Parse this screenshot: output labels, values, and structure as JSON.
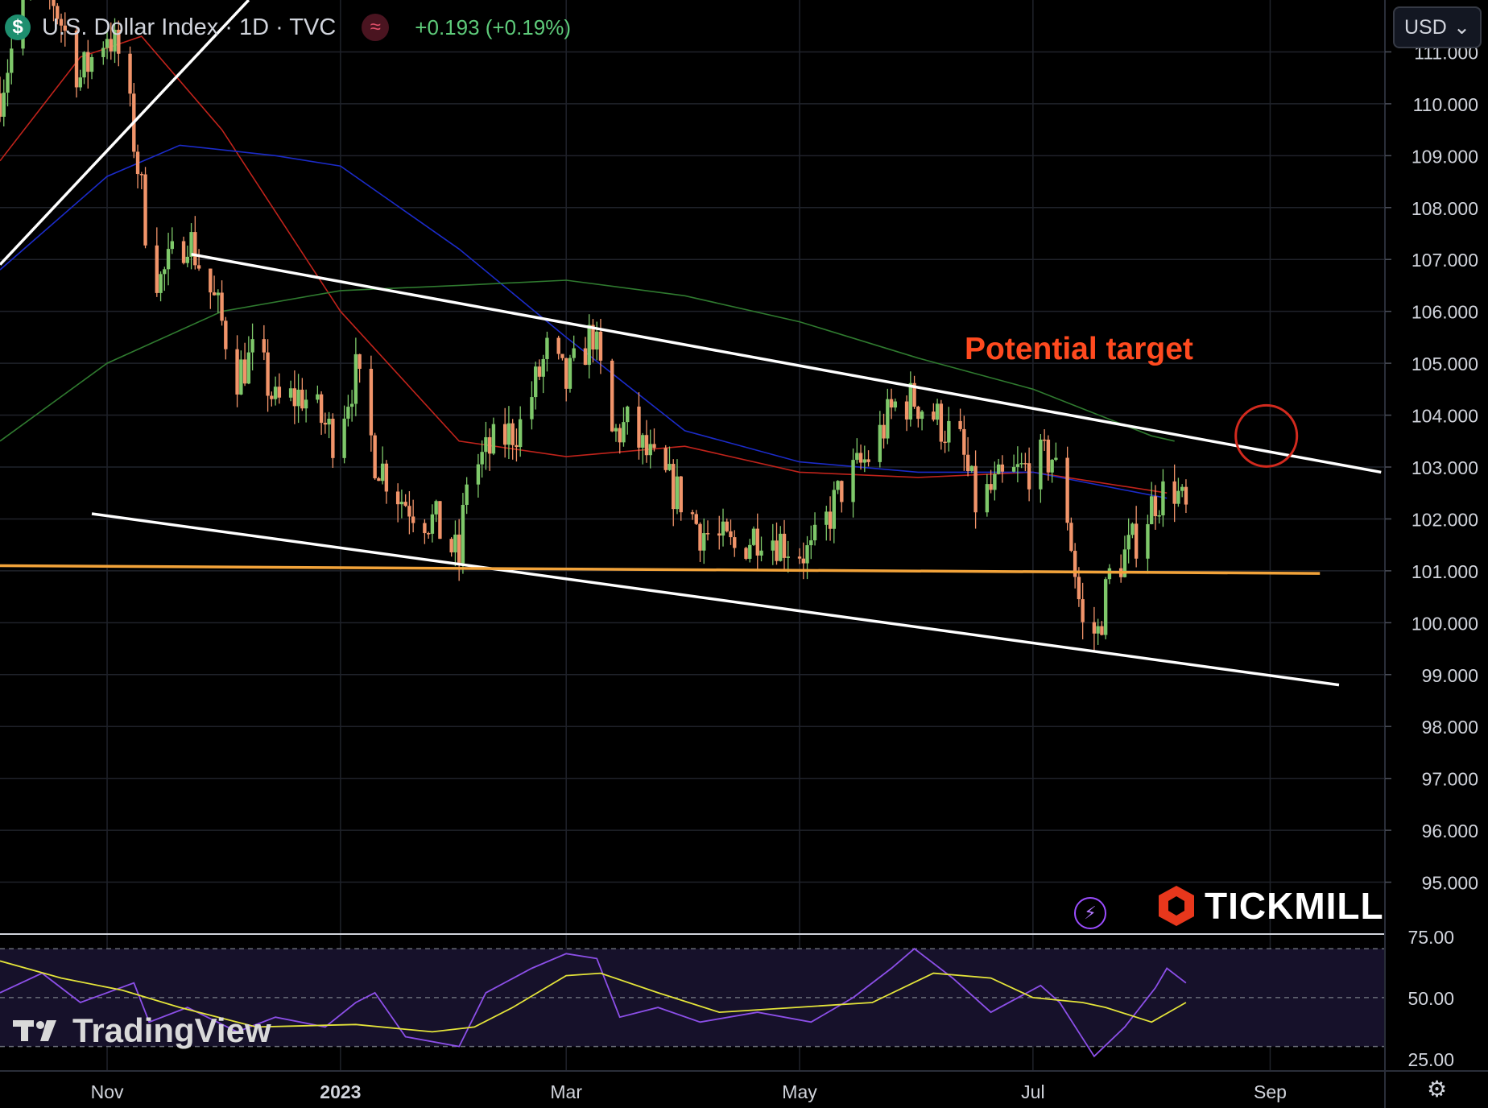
{
  "header": {
    "currency_icon": "dollar-coin-icon",
    "symbol_title": "U.S. Dollar Index · 1D · TVC",
    "indicator_icon": "wave-approx-icon",
    "change_text": "+0.193 (+0.19%)"
  },
  "currency_select": {
    "value": "USD",
    "icon": "chevron-down-icon"
  },
  "annotation": {
    "text": "Potential target",
    "color": "#ff4a1f"
  },
  "brand": {
    "name": "TICKMILL",
    "icon": "tickmill-hex-icon"
  },
  "watermark": {
    "name": "TradingView",
    "icon": "tradingview-logo-icon"
  },
  "icons": {
    "bolt": "lightning-bolt-icon",
    "settings": "gear-icon"
  },
  "colors": {
    "up": "#7ec86a",
    "down": "#f1946a",
    "ma_red": "#c0231b",
    "ma_blue": "#1b2bc8",
    "ma_green": "#2f7a2f",
    "support": "#f2a33a",
    "rsi": "#8c4fe8",
    "rsi_ma": "#e4e43a"
  },
  "chart_data": [
    {
      "type": "candlestick",
      "x_tick_labels": [
        "Nov",
        "2023",
        "Mar",
        "May",
        "Jul",
        "Sep"
      ],
      "x_tick_dates": [
        "2022-11-01",
        "2023-01-01",
        "2023-03-01",
        "2023-05-01",
        "2023-07-01",
        "2023-09-01"
      ],
      "x_range": [
        "2022-10-04",
        "2023-10-01"
      ],
      "y_range": [
        94.0,
        112.0
      ],
      "y_ticks": [
        111,
        110,
        109,
        108,
        107,
        106,
        105,
        104,
        103,
        102,
        101,
        100,
        99,
        98,
        97,
        96,
        95
      ],
      "y_tick_labels": [
        "111.000",
        "110.000",
        "109.000",
        "108.000",
        "107.000",
        "106.000",
        "105.000",
        "104.000",
        "103.000",
        "102.000",
        "101.000",
        "100.000",
        "99.000",
        "98.000",
        "97.000",
        "96.000",
        "95.000"
      ],
      "grid": true,
      "close_path": [
        [
          "2022-10-04",
          110.2
        ],
        [
          "2022-10-12",
          112.4
        ],
        [
          "2022-10-18",
          112.0
        ],
        [
          "2022-10-25",
          110.5
        ],
        [
          "2022-11-01",
          111.4
        ],
        [
          "2022-11-05",
          110.8
        ],
        [
          "2022-11-10",
          108.3
        ],
        [
          "2022-11-12",
          107.0
        ],
        [
          "2022-11-15",
          106.6
        ],
        [
          "2022-11-22",
          107.5
        ],
        [
          "2022-11-30",
          106.0
        ],
        [
          "2022-12-05",
          104.8
        ],
        [
          "2022-12-10",
          105.2
        ],
        [
          "2022-12-15",
          104.2
        ],
        [
          "2022-12-22",
          104.4
        ],
        [
          "2022-12-30",
          103.6
        ],
        [
          "2023-01-05",
          104.8
        ],
        [
          "2023-01-10",
          103.2
        ],
        [
          "2023-01-17",
          102.4
        ],
        [
          "2023-01-26",
          101.9
        ],
        [
          "2023-02-01",
          101.2
        ],
        [
          "2023-02-03",
          102.8
        ],
        [
          "2023-02-10",
          103.4
        ],
        [
          "2023-02-17",
          103.8
        ],
        [
          "2023-02-24",
          105.2
        ],
        [
          "2023-03-01",
          104.6
        ],
        [
          "2023-03-08",
          105.6
        ],
        [
          "2023-03-13",
          103.6
        ],
        [
          "2023-03-17",
          103.8
        ],
        [
          "2023-03-24",
          103.0
        ],
        [
          "2023-03-31",
          102.4
        ],
        [
          "2023-04-05",
          101.8
        ],
        [
          "2023-04-14",
          101.4
        ],
        [
          "2023-04-21",
          101.8
        ],
        [
          "2023-04-28",
          101.5
        ],
        [
          "2023-05-04",
          101.3
        ],
        [
          "2023-05-12",
          102.6
        ],
        [
          "2023-05-19",
          103.2
        ],
        [
          "2023-05-26",
          104.2
        ],
        [
          "2023-05-31",
          104.3
        ],
        [
          "2023-06-05",
          104.0
        ],
        [
          "2023-06-12",
          103.4
        ],
        [
          "2023-06-16",
          102.3
        ],
        [
          "2023-06-23",
          102.7
        ],
        [
          "2023-06-30",
          103.0
        ],
        [
          "2023-07-06",
          103.2
        ],
        [
          "2023-07-10",
          102.1
        ],
        [
          "2023-07-14",
          99.9
        ],
        [
          "2023-07-18",
          99.8
        ],
        [
          "2023-07-21",
          100.9
        ],
        [
          "2023-07-27",
          101.5
        ],
        [
          "2023-08-02",
          102.4
        ],
        [
          "2023-08-07",
          102.6
        ],
        [
          "2023-08-10",
          102.1
        ]
      ],
      "moving_averages": [
        {
          "color": "#c0231b",
          "points": [
            [
              "2022-10-04",
              108.9
            ],
            [
              "2022-10-25",
              110.9
            ],
            [
              "2022-11-10",
              111.3
            ],
            [
              "2022-12-01",
              109.5
            ],
            [
              "2023-01-01",
              106.0
            ],
            [
              "2023-02-01",
              103.5
            ],
            [
              "2023-03-01",
              103.2
            ],
            [
              "2023-04-01",
              103.4
            ],
            [
              "2023-05-01",
              102.9
            ],
            [
              "2023-06-01",
              102.8
            ],
            [
              "2023-07-01",
              102.9
            ],
            [
              "2023-08-05",
              102.5
            ]
          ]
        },
        {
          "color": "#1b2bc8",
          "points": [
            [
              "2022-10-04",
              106.8
            ],
            [
              "2022-11-01",
              108.6
            ],
            [
              "2022-11-20",
              109.2
            ],
            [
              "2022-12-15",
              109.0
            ],
            [
              "2023-01-01",
              108.8
            ],
            [
              "2023-02-01",
              107.2
            ],
            [
              "2023-03-01",
              105.5
            ],
            [
              "2023-04-01",
              103.7
            ],
            [
              "2023-05-01",
              103.1
            ],
            [
              "2023-06-01",
              102.9
            ],
            [
              "2023-07-01",
              102.9
            ],
            [
              "2023-08-05",
              102.4
            ]
          ]
        },
        {
          "color": "#2f7a2f",
          "points": [
            [
              "2022-10-04",
              103.5
            ],
            [
              "2022-11-01",
              105.0
            ],
            [
              "2022-12-01",
              106.0
            ],
            [
              "2023-01-01",
              106.4
            ],
            [
              "2023-02-01",
              106.5
            ],
            [
              "2023-03-01",
              106.6
            ],
            [
              "2023-04-01",
              106.3
            ],
            [
              "2023-05-01",
              105.8
            ],
            [
              "2023-06-01",
              105.1
            ],
            [
              "2023-07-01",
              104.5
            ],
            [
              "2023-08-01",
              103.6
            ],
            [
              "2023-08-07",
              103.5
            ]
          ]
        }
      ],
      "trendlines": [
        {
          "color": "#ffffff",
          "points": [
            [
              "2022-10-04",
              106.9
            ],
            [
              "2022-12-08",
              112.0
            ]
          ]
        },
        {
          "color": "#ffffff",
          "points": [
            [
              "2022-11-23",
              107.1
            ],
            [
              "2023-09-30",
              102.9
            ]
          ]
        },
        {
          "color": "#ffffff",
          "points": [
            [
              "2022-10-28",
              102.1
            ],
            [
              "2023-09-19",
              98.8
            ]
          ]
        },
        {
          "color": "#f2a33a",
          "points": [
            [
              "2022-10-04",
              101.1
            ],
            [
              "2023-09-14",
              100.95
            ]
          ]
        }
      ],
      "target_circle": {
        "date": "2023-08-31",
        "price": 103.6
      }
    },
    {
      "type": "line",
      "name": "RSI",
      "y_range": [
        20,
        76
      ],
      "y_ticks": [
        75,
        50,
        25
      ],
      "y_tick_labels": [
        "75.00",
        "50.00",
        "25.00"
      ],
      "band": [
        30,
        70
      ],
      "series": [
        {
          "color": "#8c4fe8",
          "points": [
            [
              "2022-10-04",
              52
            ],
            [
              "2022-10-15",
              60
            ],
            [
              "2022-10-25",
              48
            ],
            [
              "2022-11-08",
              56
            ],
            [
              "2022-11-12",
              40
            ],
            [
              "2022-11-22",
              46
            ],
            [
              "2022-12-05",
              36
            ],
            [
              "2022-12-15",
              42
            ],
            [
              "2022-12-28",
              38
            ],
            [
              "2023-01-05",
              48
            ],
            [
              "2023-01-10",
              52
            ],
            [
              "2023-01-18",
              34
            ],
            [
              "2023-02-01",
              30
            ],
            [
              "2023-02-08",
              52
            ],
            [
              "2023-02-20",
              62
            ],
            [
              "2023-03-01",
              68
            ],
            [
              "2023-03-09",
              66
            ],
            [
              "2023-03-15",
              42
            ],
            [
              "2023-03-25",
              46
            ],
            [
              "2023-04-05",
              40
            ],
            [
              "2023-04-20",
              44
            ],
            [
              "2023-05-04",
              40
            ],
            [
              "2023-05-15",
              50
            ],
            [
              "2023-05-25",
              62
            ],
            [
              "2023-05-31",
              70
            ],
            [
              "2023-06-10",
              58
            ],
            [
              "2023-06-20",
              44
            ],
            [
              "2023-07-03",
              55
            ],
            [
              "2023-07-08",
              48
            ],
            [
              "2023-07-17",
              26
            ],
            [
              "2023-07-25",
              38
            ],
            [
              "2023-08-02",
              54
            ],
            [
              "2023-08-05",
              62
            ],
            [
              "2023-08-10",
              56
            ]
          ]
        },
        {
          "color": "#e4e43a",
          "points": [
            [
              "2022-10-04",
              65
            ],
            [
              "2022-10-20",
              58
            ],
            [
              "2022-11-05",
              53
            ],
            [
              "2022-11-20",
              46
            ],
            [
              "2022-12-10",
              38
            ],
            [
              "2023-01-05",
              39
            ],
            [
              "2023-01-25",
              36
            ],
            [
              "2023-02-05",
              38
            ],
            [
              "2023-02-15",
              46
            ],
            [
              "2023-03-01",
              59
            ],
            [
              "2023-03-10",
              60
            ],
            [
              "2023-03-25",
              52
            ],
            [
              "2023-04-10",
              44
            ],
            [
              "2023-04-30",
              46
            ],
            [
              "2023-05-20",
              48
            ],
            [
              "2023-06-05",
              60
            ],
            [
              "2023-06-20",
              58
            ],
            [
              "2023-07-01",
              50
            ],
            [
              "2023-07-14",
              48
            ],
            [
              "2023-07-20",
              46
            ],
            [
              "2023-08-01",
              40
            ],
            [
              "2023-08-10",
              48
            ]
          ]
        }
      ]
    }
  ]
}
